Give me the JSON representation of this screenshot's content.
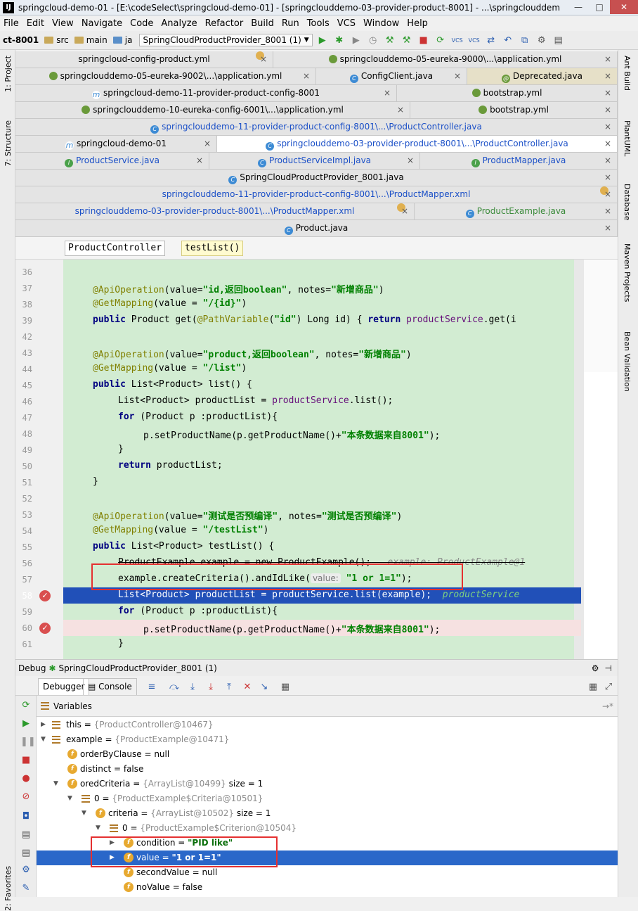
{
  "window": {
    "title": "springcloud-demo-01 - [E:\\codeSelect\\springcloud-demo-01] - [springclouddemo-03-provider-product-8001] - ...\\springclouddem",
    "controls": [
      "—",
      "□",
      "✕"
    ]
  },
  "menu": [
    "File",
    "Edit",
    "View",
    "Navigate",
    "Code",
    "Analyze",
    "Refactor",
    "Build",
    "Run",
    "Tools",
    "VCS",
    "Window",
    "Help"
  ],
  "navbar": {
    "crumbs": [
      "ct-8001",
      "src",
      "main",
      "ja"
    ],
    "run_config": "SpringCloudProductProvider_8001 (1)"
  },
  "tool_strip_left": [
    "1: Project",
    "7: Structure",
    "2: Favorites"
  ],
  "tool_strip_right": [
    "Ant Build",
    "PlantUML",
    "Database",
    "Maven Projects",
    "Bean Validation"
  ],
  "tabs": [
    [
      "springcloud-config-product.yml",
      "springclouddemo-05-eureka-9000\\...\\application.yml"
    ],
    [
      "springclouddemo-05-eureka-9002\\...\\application.yml",
      "ConfigClient.java",
      "Deprecated.java"
    ],
    [
      "springcloud-demo-11-provider-product-config-8001",
      "bootstrap.yml"
    ],
    [
      "springclouddemo-10-eureka-config-6001\\...\\application.yml",
      "bootstrap.yml"
    ],
    [
      "springclouddemo-11-provider-product-config-8001\\...\\ProductController.java"
    ],
    [
      "springcloud-demo-01",
      "springclouddemo-03-provider-product-8001\\...\\ProductController.java"
    ],
    [
      "ProductService.java",
      "ProductServiceImpl.java",
      "ProductMapper.java"
    ],
    [
      "SpringCloudProductProvider_8001.java"
    ],
    [
      "springclouddemo-11-provider-product-config-8001\\...\\ProductMapper.xml"
    ],
    [
      "springclouddemo-03-provider-product-8001\\...\\ProductMapper.xml",
      "ProductExample.java"
    ],
    [
      "Product.java"
    ]
  ],
  "breadcrumbs": [
    "ProductController",
    "testList()"
  ],
  "code": {
    "line_numbers": [
      "36",
      "37",
      "38",
      "39",
      "42",
      "43",
      "44",
      "45",
      "46",
      "47",
      "48",
      "49",
      "50",
      "51",
      "52",
      "53",
      "54",
      "55",
      "56",
      "57",
      "58",
      "59",
      "60",
      "61"
    ],
    "lines": {
      "l37_ann": "@ApiOperation",
      "l37_a": "(value=",
      "l37_s1": "\"id,返回boolean\"",
      "l37_b": ", notes=",
      "l37_s2": "\"新增商品\"",
      "l37_c": ")",
      "l38_ann": "@GetMapping",
      "l38_a": "(value = ",
      "l38_s": "\"/{id}\"",
      "l38_b": ")",
      "l39_kw": "public",
      "l39_a": " Product get(",
      "l39_ann": "@PathVariable",
      "l39_b": "(",
      "l39_s": "\"id\"",
      "l39_c": ") Long id) { ",
      "l39_kw2": "return",
      "l39_d": " ",
      "l39_fn": "productService",
      "l39_e": ".get(i",
      "l43_ann": "@ApiOperation",
      "l43_a": "(value=",
      "l43_s1": "\"product,返回boolean\"",
      "l43_b": ", notes=",
      "l43_s2": "\"新增商品\"",
      "l43_c": ")",
      "l44_ann": "@GetMapping",
      "l44_a": "(value = ",
      "l44_s": "\"/list\"",
      "l44_b": ")",
      "l45_kw": "public",
      "l45_a": " List<Product> list() {",
      "l46_a": "List<Product> productList = ",
      "l46_fn": "productService",
      "l46_b": ".list();",
      "l47_kw": "for",
      "l47_a": " (Product p :productList){",
      "l48_a": "p.setProductName(p.getProductName()+",
      "l48_s": "\"本条数据来自8001\"",
      "l48_b": ");",
      "l49": "}",
      "l50_kw": "return",
      "l50_a": " productList;",
      "l51": "}",
      "l53_ann": "@ApiOperation",
      "l53_a": "(value=",
      "l53_s1": "\"测试是否预编译\"",
      "l53_b": ", notes=",
      "l53_s2": "\"测试是否预编译\"",
      "l53_c": ")",
      "l54_ann": "@GetMapping",
      "l54_a": "(value = ",
      "l54_s": "\"/testList\"",
      "l54_b": ")",
      "l55_kw": "public",
      "l55_a": " List<Product> testList() {",
      "l56_a": "ProductExample example = new ProductExample();",
      "l56_hint": "   example: ProductExample@1",
      "l57_a": "example.createCriteria().andIdLike(",
      "l57_hint": "value:",
      "l57_s": " \"1 or 1=1\"",
      "l57_b": ");",
      "l58_a": "List<Product> productList = productService.list(example);",
      "l58_hint": "  productService",
      "l59_kw": "for",
      "l59_a": " (Product p :productList){",
      "l60_a": "p.setProductName(p.getProductName()+",
      "l60_s": "\"本条数据来自8001\"",
      "l60_b": ");",
      "l61": "}"
    }
  },
  "debug": {
    "label": "Debug",
    "config": "SpringCloudProductProvider_8001 (1)",
    "tabs": [
      "Debugger",
      "Console"
    ],
    "variables_title": "Variables",
    "rows": [
      {
        "name": "this",
        "eq": " = ",
        "val": "{ProductController@10467}",
        "extra": ""
      },
      {
        "name": "example",
        "eq": " = ",
        "val": "{ProductExample@10471}",
        "extra": ""
      },
      {
        "name": "orderByClause",
        "eq": " = ",
        "val": "null",
        "extra": ""
      },
      {
        "name": "distinct",
        "eq": " = ",
        "val": "false",
        "extra": ""
      },
      {
        "name": "oredCriteria",
        "eq": " = ",
        "val": "{ArrayList@10499}",
        "extra": "  size = 1"
      },
      {
        "name": "0",
        "eq": " = ",
        "val": "{ProductExample$Criteria@10501}",
        "extra": ""
      },
      {
        "name": "criteria",
        "eq": " = ",
        "val": "{ArrayList@10502}",
        "extra": "  size = 1"
      },
      {
        "name": "0",
        "eq": " = ",
        "val": "{ProductExample$Criterion@10504}",
        "extra": ""
      },
      {
        "name": "condition",
        "eq": " = ",
        "val": "\"PID like\"",
        "extra": ""
      },
      {
        "name": "value",
        "eq": " = ",
        "val": "\"1 or 1=1\"",
        "extra": ""
      },
      {
        "name": "secondValue",
        "eq": " = ",
        "val": "null",
        "extra": ""
      },
      {
        "name": "noValue",
        "eq": " = ",
        "val": "false",
        "extra": ""
      }
    ]
  },
  "colors": {
    "selection": "#2150b8",
    "highlight_box": "#e53030",
    "code_bg": "#d2ecd2"
  }
}
